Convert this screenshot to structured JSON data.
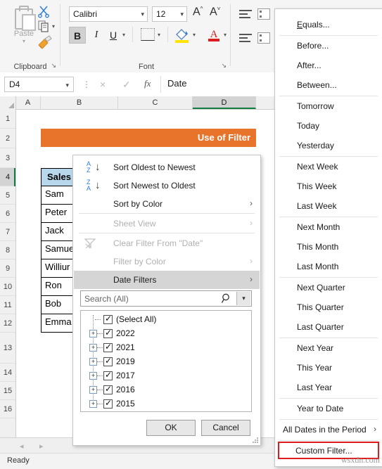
{
  "ribbon": {
    "clipboard": {
      "group_label": "Clipboard",
      "paste_label": "Paste",
      "cut_icon": "scissors-icon",
      "copy_icon": "copy-icon",
      "format_painter_icon": "format-painter-icon",
      "dialog_launcher": "↘"
    },
    "font": {
      "group_label": "Font",
      "font_name": "Calibri",
      "font_size": "12",
      "grow_font": "A",
      "shrink_font": "A",
      "bold": "B",
      "italic": "I",
      "underline": "U",
      "borders_icon": "borders-icon",
      "fill_color_icon": "fill-color-icon",
      "font_color_icon": "font-color-icon",
      "dialog_launcher": "↘"
    },
    "alignment": {
      "top_align_icon": "align-top-icon",
      "middle_align_icon": "align-middle-icon",
      "orientation_icon": "orientation-icon",
      "wrap_text_icon": "wrap-text-icon"
    }
  },
  "formula_bar": {
    "name_box": "D4",
    "cancel_icon": "×",
    "enter_icon": "✓",
    "fx_icon": "fx",
    "value": "Date"
  },
  "grid": {
    "columns": [
      "A",
      "B",
      "C",
      "D"
    ],
    "active_column": "D",
    "rows": [
      "1",
      "2",
      "3",
      "4",
      "5",
      "6",
      "7",
      "8",
      "9",
      "10",
      "11",
      "12",
      "13",
      "14",
      "15",
      "16"
    ],
    "active_row": "4",
    "title_banner": "Use of Filter",
    "table_header": "Sales",
    "cells": [
      "Sam",
      "Peter",
      "Jack",
      "Samuel",
      "Williur",
      "Ron",
      "Bob",
      "Emma"
    ]
  },
  "filter_panel": {
    "menu_items": [
      {
        "label": "Sort Oldest to Newest",
        "icon": "sort-az-icon",
        "disabled": false,
        "submenu": false,
        "highlighted": false
      },
      {
        "label": "Sort Newest to Oldest",
        "icon": "sort-za-icon",
        "disabled": false,
        "submenu": false,
        "highlighted": false
      },
      {
        "label": "Sort by Color",
        "icon": "",
        "disabled": false,
        "submenu": true,
        "highlighted": false
      },
      {
        "label": "Sheet View",
        "icon": "",
        "disabled": true,
        "submenu": true,
        "highlighted": false
      },
      {
        "label": "Clear Filter From \"Date\"",
        "icon": "clear-filter-icon",
        "disabled": true,
        "submenu": false,
        "highlighted": false
      },
      {
        "label": "Filter by Color",
        "icon": "",
        "disabled": true,
        "submenu": true,
        "highlighted": false
      },
      {
        "label": "Date Filters",
        "icon": "",
        "disabled": false,
        "submenu": true,
        "highlighted": true
      }
    ],
    "search_placeholder": "Search (All)",
    "search_icon": "search-icon",
    "search_dropdown_icon": "chevron-down-icon",
    "tree_items": [
      {
        "label": "(Select All)",
        "checked": true,
        "expandable": false
      },
      {
        "label": "2022",
        "checked": true,
        "expandable": true
      },
      {
        "label": "2021",
        "checked": true,
        "expandable": true
      },
      {
        "label": "2019",
        "checked": true,
        "expandable": true
      },
      {
        "label": "2017",
        "checked": true,
        "expandable": true
      },
      {
        "label": "2016",
        "checked": true,
        "expandable": true
      },
      {
        "label": "2015",
        "checked": true,
        "expandable": true
      }
    ],
    "ok_label": "OK",
    "cancel_label": "Cancel"
  },
  "date_submenu": {
    "items": [
      {
        "label": "Equals...",
        "sep_after": true,
        "submenu": false
      },
      {
        "label": "Before...",
        "sep_after": false,
        "submenu": false
      },
      {
        "label": "After...",
        "sep_after": false,
        "submenu": false
      },
      {
        "label": "Between...",
        "sep_after": true,
        "submenu": false
      },
      {
        "label": "Tomorrow",
        "sep_after": false,
        "submenu": false
      },
      {
        "label": "Today",
        "sep_after": false,
        "submenu": false
      },
      {
        "label": "Yesterday",
        "sep_after": true,
        "submenu": false
      },
      {
        "label": "Next Week",
        "sep_after": false,
        "submenu": false
      },
      {
        "label": "This Week",
        "sep_after": false,
        "submenu": false
      },
      {
        "label": "Last Week",
        "sep_after": true,
        "submenu": false
      },
      {
        "label": "Next Month",
        "sep_after": false,
        "submenu": false
      },
      {
        "label": "This Month",
        "sep_after": false,
        "submenu": false
      },
      {
        "label": "Last Month",
        "sep_after": true,
        "submenu": false
      },
      {
        "label": "Next Quarter",
        "sep_after": false,
        "submenu": false
      },
      {
        "label": "This Quarter",
        "sep_after": false,
        "submenu": false
      },
      {
        "label": "Last Quarter",
        "sep_after": true,
        "submenu": false
      },
      {
        "label": "Next Year",
        "sep_after": false,
        "submenu": false
      },
      {
        "label": "This Year",
        "sep_after": false,
        "submenu": false
      },
      {
        "label": "Last Year",
        "sep_after": true,
        "submenu": false
      },
      {
        "label": "Year to Date",
        "sep_after": true,
        "submenu": false
      },
      {
        "label": "All Dates in the Period",
        "sep_after": true,
        "submenu": true
      },
      {
        "label": "Custom Filter...",
        "sep_after": false,
        "submenu": false,
        "highlight_box": true
      }
    ]
  },
  "sheet_bar": {
    "prev_icon": "◂",
    "next_icon": "▸"
  },
  "status_bar": {
    "text": "Ready"
  },
  "watermark": "wsxdn.com",
  "colors": {
    "banner_orange": "#e8742c",
    "header_blue": "#b8d6ec",
    "highlight_red": "#e01b1b",
    "excel_green": "#107c41"
  }
}
